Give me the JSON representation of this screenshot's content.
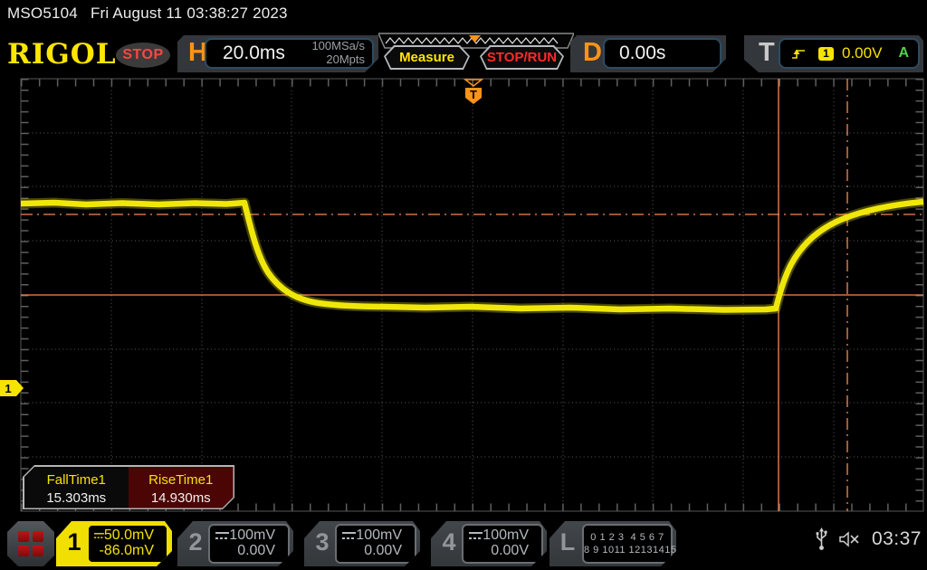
{
  "titlebar": {
    "model": "MSO5104",
    "datetime": "Fri August 11 03:38:27 2023"
  },
  "header": {
    "logo": "RIGOL",
    "run_state": "STOP",
    "horizontal": {
      "label": "H",
      "timebase": "20.0ms",
      "sample_rate": "100MSa/s",
      "memory_depth": "20Mpts"
    },
    "buttons": {
      "measure": "Measure",
      "stop_run": "STOP/RUN"
    },
    "delay": {
      "label": "D",
      "value": "0.00s"
    },
    "trigger": {
      "label": "T",
      "source": "1",
      "level": "0.00V",
      "mode": "A"
    }
  },
  "measurements": [
    {
      "name": "FallTime1",
      "value": "15.303ms"
    },
    {
      "name": "RiseTime1",
      "value": "14.930ms"
    }
  ],
  "channels": [
    {
      "number": "1",
      "scale": "50.0mV",
      "offset": "-86.0mV"
    },
    {
      "number": "2",
      "scale": "100mV",
      "offset": "0.00V"
    },
    {
      "number": "3",
      "scale": "100mV",
      "offset": "0.00V"
    },
    {
      "number": "4",
      "scale": "100mV",
      "offset": "0.00V"
    }
  ],
  "logic": {
    "label": "L",
    "row1": "0 1 2 3  4 5 6 7",
    "row2": "8 9 1011 12131415"
  },
  "statusbar": {
    "clock": "03:37"
  },
  "colors": {
    "accent_yellow": "#f5e300",
    "accent_orange": "#ff9318",
    "cursor_orange": "#f58a55",
    "trace_yellow": "#f0e70a",
    "run_red": "#ff4545",
    "mode_green": "#4fd34f"
  }
}
